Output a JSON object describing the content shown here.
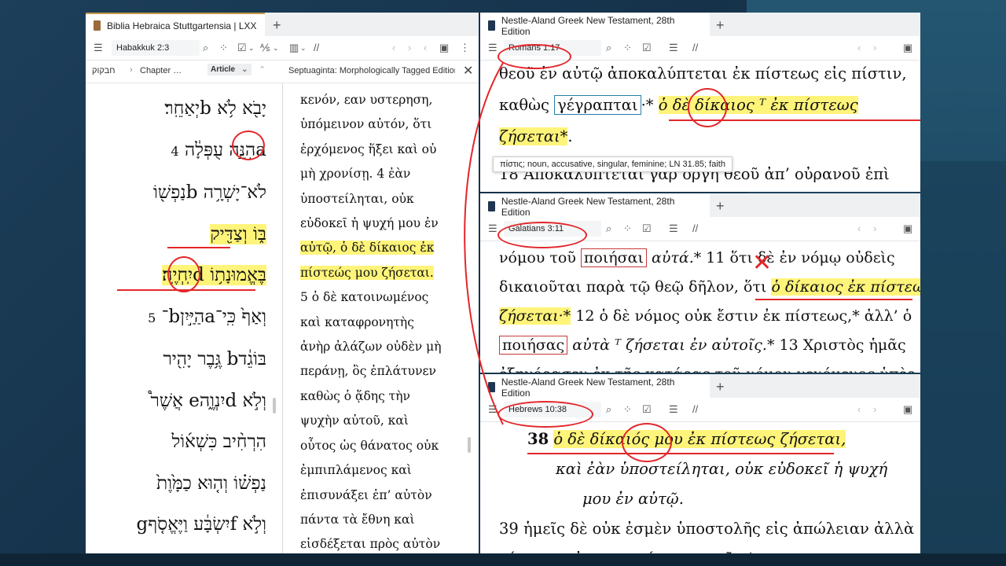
{
  "left_panel": {
    "tab_title": "Biblia Hebraica Stuttgartensia | LXX",
    "reference": "Habakkuk 2:3",
    "breadcrumb_book": "חבקוק",
    "breadcrumb_chapter": "Chapter …",
    "article_dropdown": "Article",
    "septuagint_title": "Septuaginta: Morphologically Tagged Edition",
    "hebrew_lines": [
      "יָבֹ֖א לֹ֥א bיְאַחֵֽר׃",
      "aהִנֵּ֣ה עֻפְּלָ֔ה",
      "לֹא־יָשְׁרָ֥ה bנַפְשׁ֖וֹ",
      "בּ֑וֹ וְצַדִּ֖יק",
      "בֶּאֱמוּנָת֥וֹ dיִֽחְיֶֽה׃",
      "וְאַף֙ כִּֽי־aהַיַּ֣יִןb־",
      "בּוֹגֵ֔דb גֶּ֥בֶר יָהִ֖יר",
      "וְלֹ֣א dיִנְוֶ֑הe אֲשֶׁר֩",
      "הִרְחִ֨יב כִּשְׁא֜וֹל",
      "נַפְשׁ֗וֹ וְה֤וּא כַמָּ֙וֶת֙",
      "וְלֹ֣א fיִשְׂבָּ֔ע וַיֶּאֱסֹ֤ףg"
    ],
    "hebrew_verse4": "4",
    "hebrew_verse5": "5",
    "greek_lines": [
      "κενόν, εαν υστερηση,",
      "ὑπόμεινον αὐτόν, ὅτι",
      "ἐρχόμενος ἥξει καὶ οὐ",
      "μὴ χρονίσῃ.   4 ἐὰν",
      "ὑποστείληται,    οὐκ",
      "εὐδοκεῖ ἡ ψυχή μου ἐν",
      "αὐτῷ, ὁ δὲ δίκαιος ἐκ",
      "πίστεώς μου ζήσεται.",
      "5 ὁ δὲ κατοινωμένος",
      "καὶ     καταφρονητὴς",
      "ἀνὴρ ἀλάζων οὐδὲν μὴ",
      "περάνῃ, ὃς ἐπλάτυνεν",
      "καθὼς  ὁ  ᾅδης  τὴν",
      "ψυχὴν    αὐτοῦ,    καὶ",
      "οὗτος ὡς θάνατος οὐκ",
      "ἐμπιπλάμενος       καὶ",
      "ἐπισυνάξει  ἐπ’  αὐτὸν",
      "πάντα  τὰ  ἔθνη  καὶ",
      "εἰσδέξεται πρὸς αὐτὸν"
    ]
  },
  "na28_title": "Nestle-Aland Greek New Testament, 28th Edition",
  "romans": {
    "reference": "Romans 1:17",
    "line1": "θεοῦ ἐν αὐτῷ ἀποκαλύπτεται ἐκ πίστεως εἰς πίστιν,",
    "line2_a": "καθὼς",
    "line2_box": "γέγραπται",
    "line2_star": "·*",
    "line2_hl": "ὁ δὲ δίκαιος ᵀ ἐκ πίστεως",
    "line3_hl": "ζήσεται*",
    "line3_dot": ".",
    "tooltip": "πίστις; noun, accusative, singular, feminine; LN 31.85; faith",
    "line4": "18 Ἀποκαλύπτεται γὰρ ὀργὴ θεοῦ ἀπ’ οὐρανοῦ ἐπὶ"
  },
  "galatians": {
    "reference": "Galatians 3:11",
    "line1_a": "νόμου τοῦ",
    "line1_box": "ποιήσαι",
    "line1_b": "αὐτά.*",
    "line1_c": "11 ὅτι δὲ ἐν νόμῳ οὐδεὶς",
    "line2_a": "δικαιοῦται παρὰ τῷ θεῷ δῆλον, ὅτι",
    "line2_hl": "ὁ δίκαιος ἐκ πίστεως",
    "line3_hl": "ζήσεται·*",
    "line3_b": "12 ὁ δὲ νόμος οὐκ ἔστιν ἐκ πίστεως,* ἀλλ’ ὁ",
    "line4_box": "ποιήσας",
    "line4_b": "αὐτὰ ᵀ ζήσεται ἐν αὐτοῖς.*",
    "line4_c": "13 Χριστὸς ἡμᾶς",
    "line5": "ἐξηγόρασεν ἐκ τῆς κατάρας τοῦ νόμου γενόμενος ὑπὲρ"
  },
  "hebrews": {
    "reference": "Hebrews 10:38",
    "verse": "38",
    "line1_hl": "ὁ δὲ δίκαιός μου ἐκ πίστεως ζήσεται,",
    "line2": "καὶ ἐὰν ὑποστείληται, οὐκ εὐδοκεῖ ἡ ψυχή",
    "line3": "μου ἐν αὐτῷ.",
    "line4": "39 ἡμεῖς δὲ οὐκ ἐσμὲν ὑποστολῆς εἰς ἀπώλειαν ἀλλὰ",
    "line5": "πίστεως εἰς περιποίησιν ψυχῆς.*"
  },
  "colors": {
    "highlight": "#fff47a",
    "annotation_red": "#e3262a",
    "tab_accent": "#c79a4b"
  }
}
